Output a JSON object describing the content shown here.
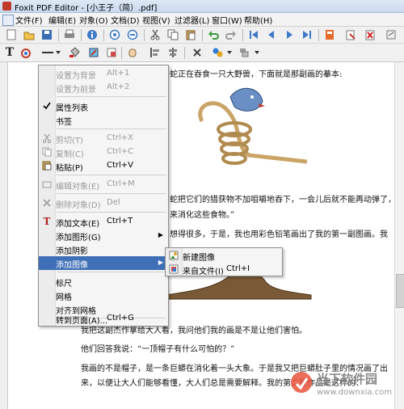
{
  "window": {
    "title": "Foxit PDF Editor - [小王子（简）.pdf]"
  },
  "menubar": {
    "items": [
      "文件(F)",
      "编辑(E)",
      "对象(O)",
      "文档(D)",
      "视图(V)",
      "过滤器(L)",
      "窗口(W)",
      "帮助(H)"
    ]
  },
  "document": {
    "line_top": "蛇正在吞食一只大野兽，下面就是那副画的摹本:",
    "line_mid1": "蛇把它们的猎获物不加咀嚼地吞下，一会儿后就不能再动弹了，",
    "line_mid2": "来消化这些食物。”",
    "line_mid3": "想得很多，于是，我也用彩色铅笔画出了我的第一副图画。我",
    "line_p1": "我把这副杰作拿给大人看，我问他们我的画是不是让他们害怕。",
    "line_p2": "他们回答我说：“一顶帽子有什么可怕的？”",
    "line_p3": "我画的不是帽子，是一条巨蟒在消化着一头大象。于是我又把巨蟒肚子里的情况画了出",
    "line_p4": "来，以便让大人们能够看懂，大人们总是需要解释。我的第二号作品是这样的："
  },
  "context_menu": {
    "set_background": {
      "label": "设置为背景",
      "shortcut": "Alt+1"
    },
    "set_foreground": {
      "label": "设置为前景",
      "shortcut": "Alt+2"
    },
    "properties_list": {
      "label": "属性列表"
    },
    "bookmarks": {
      "label": "书签"
    },
    "cut": {
      "label": "剪切(T)",
      "shortcut": "Ctrl+X"
    },
    "copy": {
      "label": "复制(C)",
      "shortcut": "Ctrl+C"
    },
    "paste": {
      "label": "粘贴(P)",
      "shortcut": "Ctrl+V"
    },
    "edit_object": {
      "label": "编辑对象(E)",
      "shortcut": "Ctrl+M"
    },
    "delete_object": {
      "label": "删除对象(D)",
      "shortcut": "Del"
    },
    "add_text": {
      "label": "添加文本(E)",
      "shortcut": "Ctrl+T"
    },
    "add_shape": {
      "label": "添加图形(G)"
    },
    "add_shadow": {
      "label": "添加阴影"
    },
    "add_image": {
      "label": "添加图像"
    },
    "ruler": {
      "label": "标尺"
    },
    "grid": {
      "label": "网格"
    },
    "snap_grid": {
      "label": "对齐到网格"
    },
    "goto_page": {
      "label": "转到页面(A)...",
      "shortcut": "Ctrl+G"
    }
  },
  "submenu": {
    "new_image": {
      "label": "新建图像"
    },
    "from_file": {
      "label": "来自文件(I)",
      "shortcut": "Ctrl+I"
    }
  },
  "watermark": {
    "text": "当下软件园",
    "url": "www.downxia.com"
  }
}
